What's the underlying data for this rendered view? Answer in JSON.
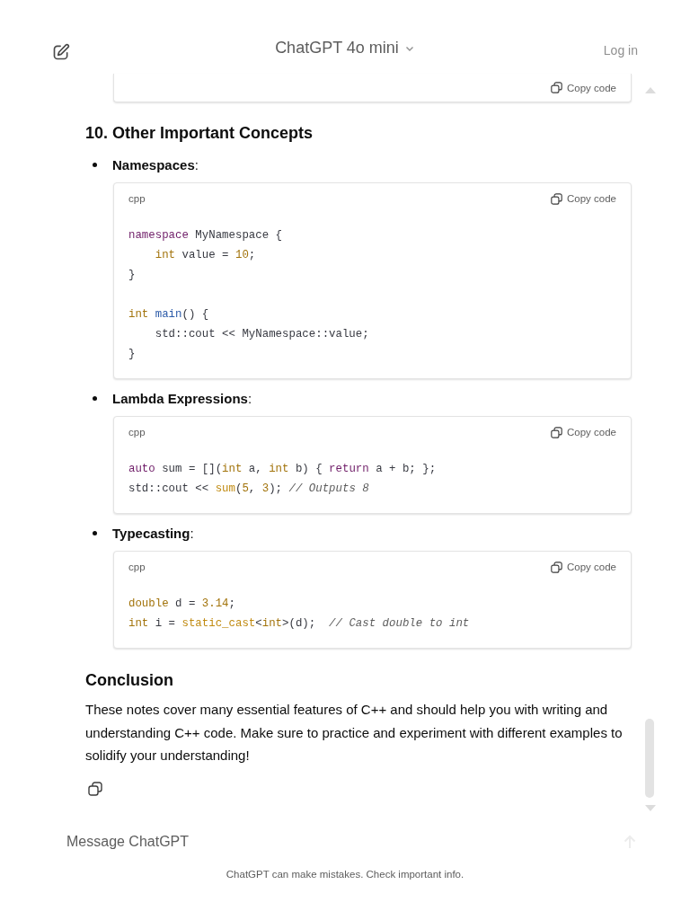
{
  "header": {
    "model": "ChatGPT 4o mini",
    "login": "Log in"
  },
  "top_code": {
    "copy": "Copy code"
  },
  "section_heading": "10. Other Important Concepts",
  "items": [
    {
      "label": "**Namespaces**:",
      "code": {
        "language": "cpp",
        "copy": "Copy code",
        "lines": [
          {
            "kind": "code",
            "tokens": [
              {
                "t": "namespace",
                "kind": "keyword"
              },
              {
                "t": " MyNamespace {",
                "kind": "plain"
              }
            ]
          },
          {
            "kind": "code",
            "tokens": [
              {
                "t": "    int",
                "kind": "type"
              },
              {
                "t": " value = ",
                "kind": "plain"
              },
              {
                "t": "10",
                "kind": "number"
              },
              {
                "t": ";",
                "kind": "plain"
              }
            ]
          },
          {
            "kind": "code",
            "tokens": [
              {
                "t": "}",
                "kind": "plain"
              }
            ]
          },
          {
            "kind": "blank"
          },
          {
            "kind": "code",
            "tokens": [
              {
                "t": "int",
                "kind": "type"
              },
              {
                "t": " main",
                "kind": "func"
              },
              {
                "t": "() {",
                "kind": "plain"
              }
            ]
          },
          {
            "kind": "code",
            "tokens": [
              {
                "t": "    std::cout << MyNamespace::value;",
                "kind": "plain"
              }
            ]
          },
          {
            "kind": "code",
            "tokens": [
              {
                "t": "}",
                "kind": "plain"
              }
            ]
          }
        ]
      }
    },
    {
      "label": "**Lambda Expressions**:",
      "code": {
        "language": "cpp",
        "copy": "Copy code",
        "lines": [
          {
            "kind": "code",
            "tokens": [
              {
                "t": "auto",
                "kind": "keyword"
              },
              {
                "t": " sum = [](",
                "kind": "plain"
              },
              {
                "t": "int",
                "kind": "type"
              },
              {
                "t": " a, ",
                "kind": "plain"
              },
              {
                "t": "int",
                "kind": "type"
              },
              {
                "t": " b) { ",
                "kind": "plain"
              },
              {
                "t": "return",
                "kind": "keyword"
              },
              {
                "t": " a + b; };",
                "kind": "plain"
              }
            ]
          },
          {
            "kind": "code",
            "tokens": [
              {
                "t": "std::cout << ",
                "kind": "plain"
              },
              {
                "t": "sum",
                "kind": "builtin"
              },
              {
                "t": "(",
                "kind": "plain"
              },
              {
                "t": "5",
                "kind": "number"
              },
              {
                "t": ", ",
                "kind": "plain"
              },
              {
                "t": "3",
                "kind": "number"
              },
              {
                "t": "); ",
                "kind": "plain"
              },
              {
                "t": "// Outputs 8",
                "kind": "comment"
              }
            ]
          }
        ]
      }
    },
    {
      "label": "**Typecasting**:",
      "code": {
        "language": "cpp",
        "copy": "Copy code",
        "lines": [
          {
            "kind": "code",
            "tokens": [
              {
                "t": "double",
                "kind": "type"
              },
              {
                "t": " d = ",
                "kind": "plain"
              },
              {
                "t": "3.14",
                "kind": "number"
              },
              {
                "t": ";",
                "kind": "plain"
              }
            ]
          },
          {
            "kind": "code",
            "tokens": [
              {
                "t": "int",
                "kind": "type"
              },
              {
                "t": " i = ",
                "kind": "plain"
              },
              {
                "t": "static_cast",
                "kind": "builtin"
              },
              {
                "t": "<",
                "kind": "plain"
              },
              {
                "t": "int",
                "kind": "type"
              },
              {
                "t": ">(d);  ",
                "kind": "plain"
              },
              {
                "t": "// Cast double to int",
                "kind": "comment"
              }
            ]
          }
        ]
      }
    }
  ],
  "conclusion": {
    "heading": "Conclusion",
    "text": "These notes cover many essential features of C++ and should help you with writing and understanding C++ code. Make sure to practice and experiment with different examples to solidify your understanding!"
  },
  "composer": {
    "placeholder": "Message ChatGPT"
  },
  "disclaimer": "ChatGPT can make mistakes. Check important info."
}
